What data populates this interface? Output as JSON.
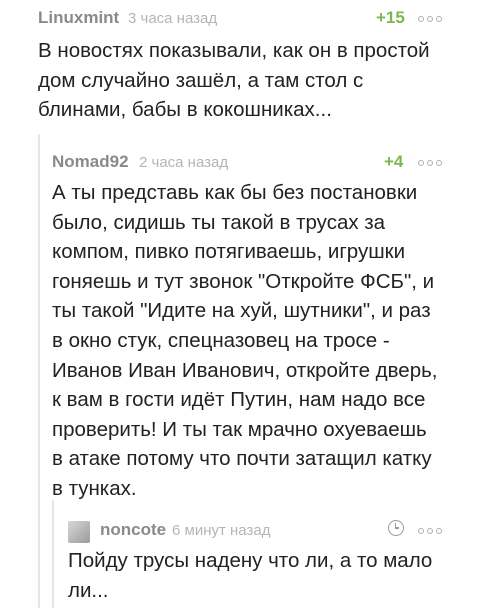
{
  "comments": [
    {
      "author": "Linuxmint",
      "time": "3 часа назад",
      "score": "+15",
      "text": "В новостях показывали, как он в простой\nдом случайно зашёл, а там стол с\nблинами, бабы в кокошниках..."
    },
    {
      "author": "Nomad92",
      "time": "2 часа назад",
      "score": "+4",
      "text": "А ты представь как бы без постановки\nбыло, сидишь ты такой в трусах за\nкомпом, пивко потягиваешь, игрушки\nгоняешь и тут звонок \"Откройте ФСБ\", и\nты такой \"Идите на хуй, шутники\", и раз\nв окно стук, спецназовец на тросе -\nИванов Иван Иванович, откройте дверь,\nк вам в гости идёт Путин, нам надо все\nпроверить! И ты так мрачно охуеваешь\nв атаке потому что почти затащил катку\nв тунках."
    },
    {
      "author": "noncote",
      "time": "6 минут назад",
      "text": "Пойду трусы надену что ли, а то мало\nли..."
    }
  ],
  "icons": {
    "more": "more-icon",
    "clock": "clock-icon",
    "avatar": "avatar"
  },
  "colors": {
    "score": "#7bb84f",
    "author": "#8a8a8a",
    "time": "#b5b5b5"
  }
}
